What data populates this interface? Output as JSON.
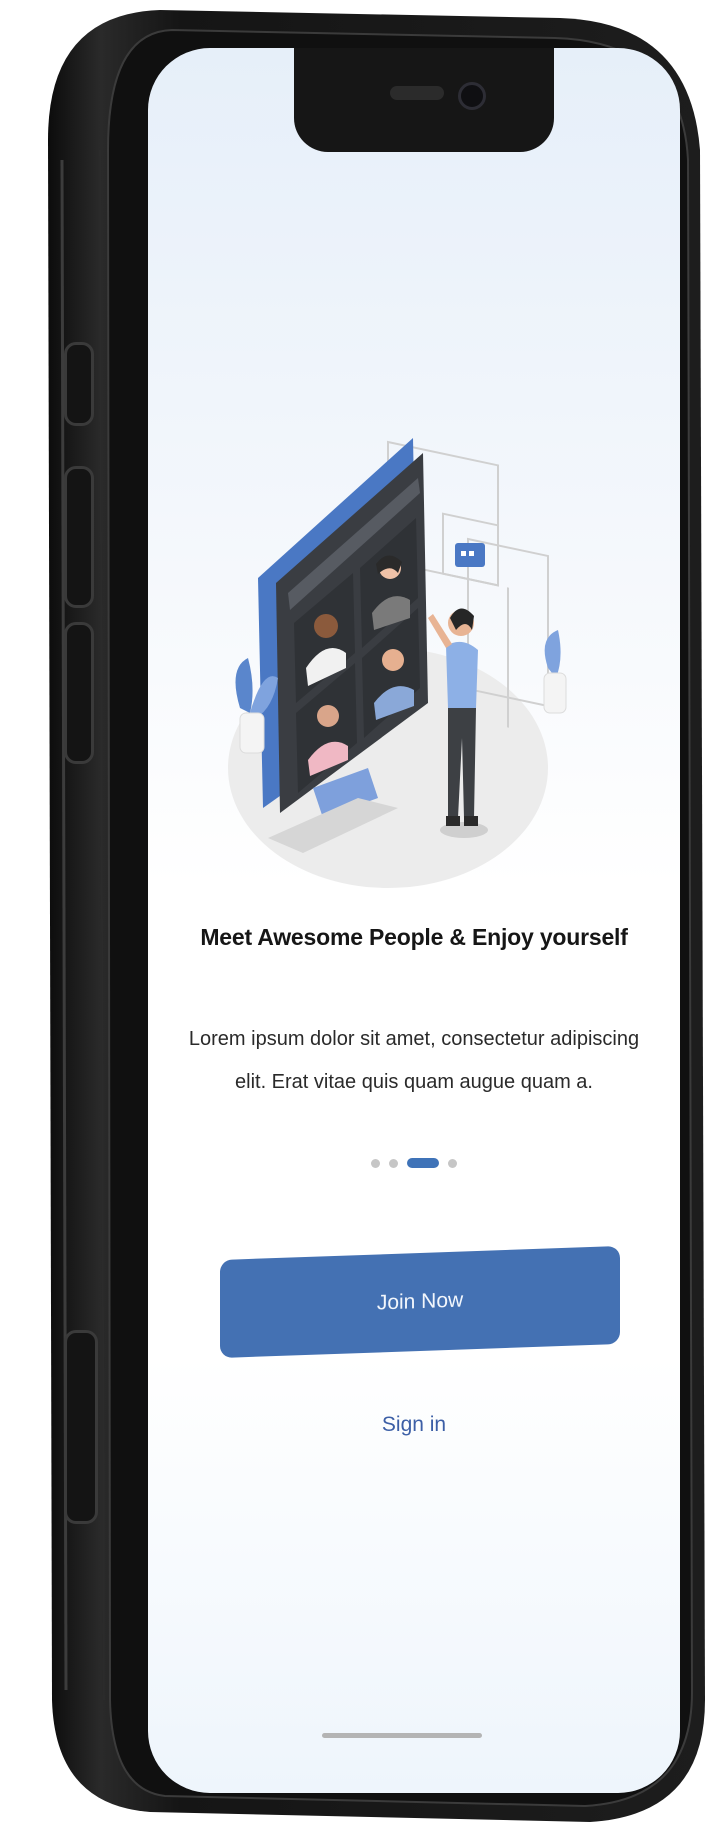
{
  "onboarding": {
    "title": "Meet Awesome People & Enjoy yourself",
    "description_line1": "Lorem ipsum dolor sit amet, consectetur adipiscing",
    "description_line2": "elit. Erat vitae quis quam augue quam a.",
    "page_indicator": {
      "total": 4,
      "active_index": 2
    },
    "primary_button_label": "Join Now",
    "secondary_link_label": "Sign in"
  },
  "illustration": {
    "name": "video-call-illustration"
  },
  "colors": {
    "accent": "#4471b3",
    "link": "#3c5fa6",
    "title": "#161616",
    "body_text": "#2a2a2a",
    "dot_inactive": "#c6c6c6",
    "phone_frame": "#1b1b1b"
  }
}
